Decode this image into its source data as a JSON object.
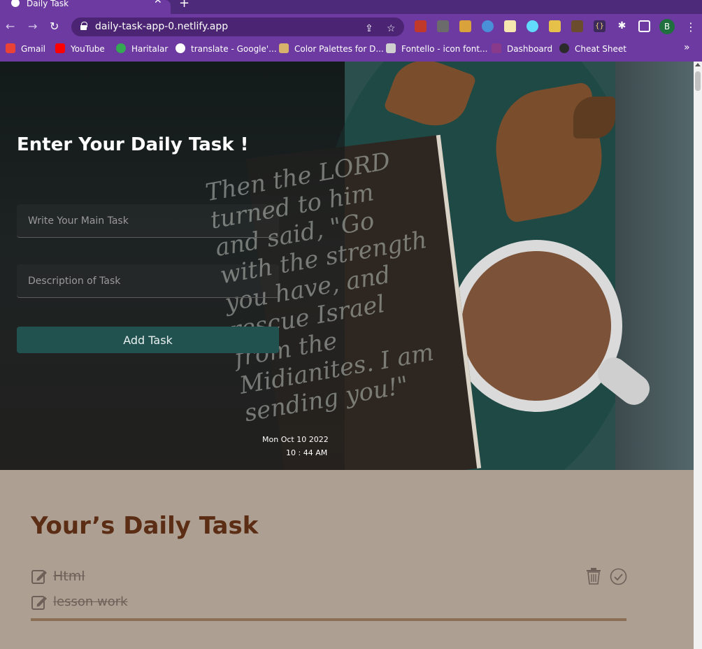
{
  "browser": {
    "tab_title": "Daily Task",
    "tab_favicon": "globe-icon",
    "url": "daily-task-app-0.netlify.app",
    "profile_initial": "B",
    "bookmarks": [
      {
        "label": "Gmail",
        "icon": "gmail-icon",
        "color": "#ea4335"
      },
      {
        "label": "YouTube",
        "icon": "youtube-icon",
        "color": "#ff0000"
      },
      {
        "label": "Haritalar",
        "icon": "maps-icon",
        "color": "#34a853"
      },
      {
        "label": "translate - Google'...",
        "icon": "google-icon",
        "color": "#ffffff"
      },
      {
        "label": "Color Palettes for D...",
        "icon": "palette-icon",
        "color": "#d7b26a"
      },
      {
        "label": "Fontello - icon font...",
        "icon": "fontello-icon",
        "color": "#cfcfcf"
      },
      {
        "label": "Dashboard",
        "icon": "dashboard-icon",
        "color": "#8a3a8a"
      },
      {
        "label": "Cheat Sheet",
        "icon": "cheatsheet-icon",
        "color": "#2b2b2b"
      }
    ]
  },
  "hero": {
    "title": "Enter Your Daily Task !",
    "handwriting": "Then the LORD turned to him and said, \"Go with the strength you have, and rescue Israel from the Midianites. I am sending you!\"",
    "task_placeholder": "Write Your Main Task",
    "description_placeholder": "Description of Task",
    "add_button": "Add Task",
    "date": "Mon Oct 10 2022",
    "time": "10 : 44 AM"
  },
  "tasks": {
    "title": "Your’s Daily Task",
    "items": [
      {
        "title": "Html",
        "done": true
      },
      {
        "title": "lesson work",
        "done": true
      }
    ]
  },
  "colors": {
    "accent": "#215250",
    "heading_brown": "#5a2d14",
    "page_bg": "#ad9f91",
    "browser_purple": "#6c3aa0"
  }
}
